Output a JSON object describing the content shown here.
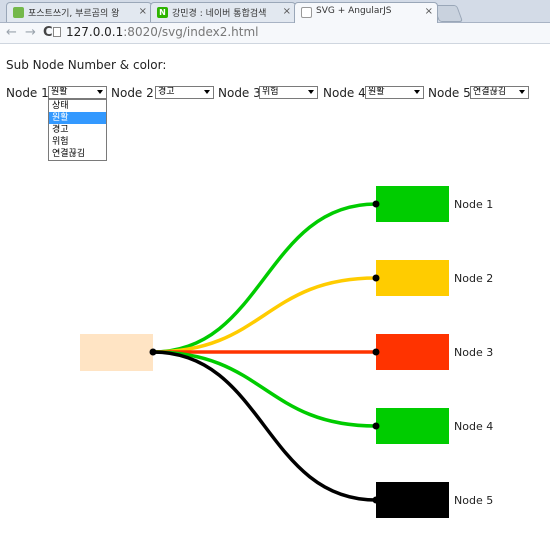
{
  "browser": {
    "tabs": [
      {
        "title": "포스트쓰기, 부르곰의 왕",
        "close": "×",
        "favicon": "",
        "favicon_color": "#74b84a"
      },
      {
        "title": "강민경 : 네이버 통합검색",
        "close": "×",
        "favicon": "N",
        "favicon_color": "#2db400"
      },
      {
        "title": "SVG + AngularJS",
        "close": "×",
        "favicon": "",
        "favicon_color": "#ffffff"
      }
    ],
    "back": "←",
    "forward": "→",
    "reload": "C",
    "url_host": "127.0.0.1",
    "url_rest": ":8020/svg/index2.html"
  },
  "page": {
    "heading": "Sub Node Number & color:",
    "nodes": [
      {
        "label": "Node 1:",
        "selected": "원활"
      },
      {
        "label": "Node 2:",
        "selected": "경고"
      },
      {
        "label": "Node 3:",
        "selected": "위험"
      },
      {
        "label": "Node 4:",
        "selected": "원활"
      },
      {
        "label": "Node 5:",
        "selected": "연결끊김"
      }
    ],
    "dropdown_options": [
      "상태",
      "원활",
      "경고",
      "위험",
      "연결끊김"
    ],
    "dropdown_highlighted": 1
  },
  "diagram": {
    "source_color": "#ffe4c4",
    "dot_color": "#000000",
    "targets": [
      {
        "label": "Node 1",
        "color": "#00cc00"
      },
      {
        "label": "Node 2",
        "color": "#ffcc00"
      },
      {
        "label": "Node 3",
        "color": "#ff3300"
      },
      {
        "label": "Node 4",
        "color": "#00cc00"
      },
      {
        "label": "Node 5",
        "color": "#000000"
      }
    ]
  }
}
